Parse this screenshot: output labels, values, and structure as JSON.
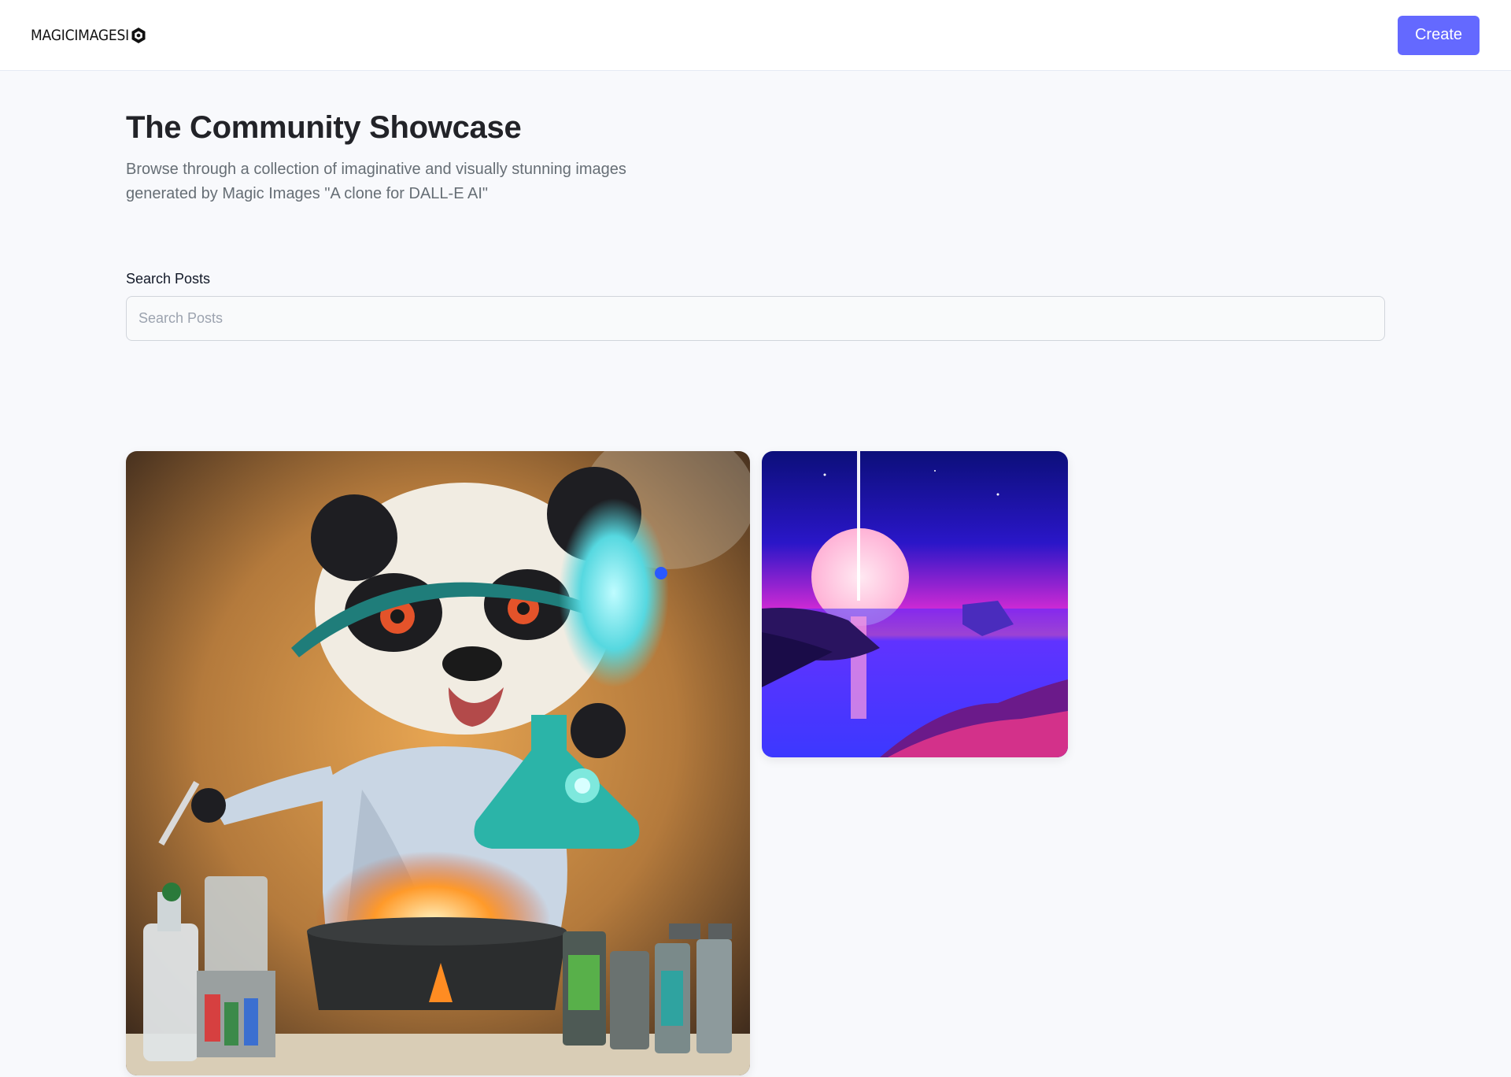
{
  "header": {
    "logo_text": "MAGICIMAGESI",
    "logo_icon": "hexagon-logo-icon",
    "create_label": "Create",
    "accent_color": "#6469ff"
  },
  "hero": {
    "title": "The Community Showcase",
    "subtitle": "Browse through a collection of imaginative and visually stunning images generated by Magic Images \"A clone for DALL-E AI\""
  },
  "search": {
    "label": "Search Posts",
    "placeholder": "Search Posts",
    "value": ""
  },
  "gallery": {
    "posts": [
      {
        "subject": "panda-scientist-painting"
      },
      {
        "subject": "synthwave-sunset-sea"
      }
    ]
  }
}
